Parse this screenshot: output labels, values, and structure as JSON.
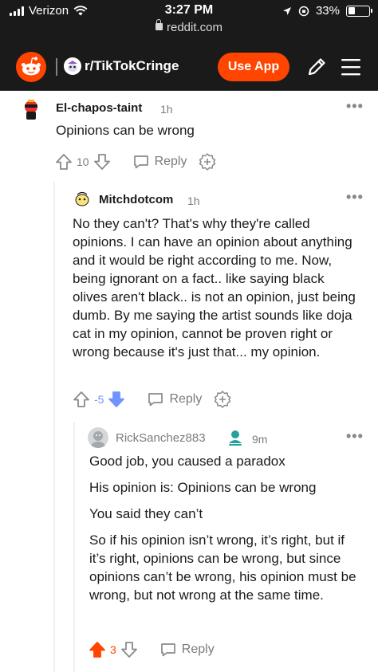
{
  "status_bar": {
    "carrier": "Verizon",
    "time": "3:27 PM",
    "battery": "33%",
    "url": "reddit.com"
  },
  "header": {
    "subreddit": "r/TikTokCringe",
    "use_app_label": "Use App"
  },
  "comments": [
    {
      "author": "El-chapos-taint",
      "time": "1h",
      "body": [
        "Opinions can be wrong"
      ],
      "score": "10",
      "reply_label": "Reply",
      "vote": "none"
    },
    {
      "author": "Mitchdotcom",
      "time": "1h",
      "body": [
        "No they can't? That's why they're called opinions. I can have an opinion about anything and it would be right according to me. Now, being ignorant on a fact.. like saying black olives aren't black.. is not an opinion, just being dumb. By me saying the artist sounds like doja cat in my opinion, cannot be proven right or wrong because it's just that... my opinion."
      ],
      "score": "-5",
      "reply_label": "Reply",
      "vote": "down"
    },
    {
      "author": "RickSanchez883",
      "time": "9m",
      "body": [
        "Good job, you caused a paradox",
        "His opinion is: Opinions can be wrong",
        "You said they can’t",
        "So if his opinion isn’t wrong, it’s right, but if it’s right, opinions can be wrong, but since opinions can’t be wrong, his opinion must be wrong, but not wrong at the same time."
      ],
      "score": "3",
      "reply_label": "Reply",
      "vote": "up"
    }
  ],
  "colors": {
    "brand": "#ff4500",
    "downvote": "#7193ff",
    "header_bg": "#1a1a1b",
    "meta_gray": "#787c7e"
  }
}
